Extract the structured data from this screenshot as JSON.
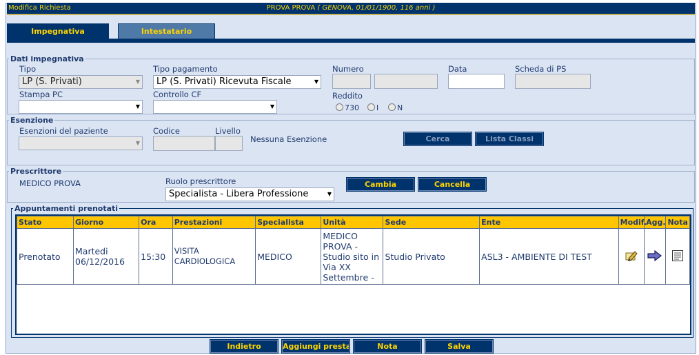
{
  "title": {
    "left": "Modifica Richiesta",
    "patient_name": "PROVA PROVA",
    "patient_details": "( GENOVA, 01/01/1900, 116 anni )"
  },
  "tabs": [
    {
      "label": "Impegnativa",
      "active": true
    },
    {
      "label": "Intestatario",
      "active": false
    }
  ],
  "dati_impegnativa": {
    "legend": "Dati impegnativa",
    "tipo_label": "Tipo",
    "tipo_value": "LP (S. Privati)",
    "tipo_pagamento_label": "Tipo pagamento",
    "tipo_pagamento_value": "LP (S. Privati) Ricevuta Fiscale",
    "numero_label": "Numero",
    "data_label": "Data",
    "scheda_label": "Scheda di PS",
    "stampa_label": "Stampa PC",
    "controllo_label": "Controllo CF",
    "reddito_label": "Reddito",
    "reddito_options": [
      "730",
      "I",
      "N"
    ]
  },
  "esenzione": {
    "legend": "Esenzione",
    "esenzioni_label": "Esenzioni del paziente",
    "codice_label": "Codice",
    "livello_label": "Livello",
    "status_text": "Nessuna Esenzione",
    "cerca_label": "Cerca",
    "lista_classi_label": "Lista Classi"
  },
  "prescrittore": {
    "legend": "Prescrittore",
    "name": "MEDICO PROVA",
    "ruolo_label": "Ruolo prescrittore",
    "ruolo_value": "Specialista - Libera Professione",
    "cambia_label": "Cambia",
    "cancella_label": "Cancella"
  },
  "appuntamenti": {
    "legend": "Appuntamenti prenotati",
    "columns": [
      "Stato",
      "Giorno",
      "Ora",
      "Prestazioni",
      "Specialista",
      "Unità",
      "Sede",
      "Ente",
      "Modif.",
      "Agg.",
      "Nota"
    ],
    "rows": [
      {
        "stato": "Prenotato",
        "giorno_1": "Martedi",
        "giorno_2": "06/12/2016",
        "ora": "15:30",
        "prestazioni_1": "VISITA",
        "prestazioni_2": "CARDIOLOGICA",
        "specialista": "MEDICO",
        "unita_1": "MEDICO",
        "unita_2": "PROVA -",
        "unita_3": "Studio sito in",
        "unita_4": "Via XX",
        "unita_5": "Settembre -",
        "sede": "Studio Privato",
        "ente": "ASL3 - AMBIENTE DI TEST",
        "modif_icon": "edit-pencil-icon",
        "agg_icon": "arrow-right-icon",
        "nota_icon": "note-document-icon"
      }
    ]
  },
  "footer_buttons": {
    "indietro": "Indietro",
    "aggiungi": "Aggiungi presta",
    "nota": "Nota",
    "salva": "Salva"
  },
  "colors": {
    "navy": "#00336c",
    "gold": "#ffd400",
    "header_yellow": "#ffc600",
    "panel_bg": "#dbe4f3",
    "inactive_tab": "#4f79a6"
  }
}
